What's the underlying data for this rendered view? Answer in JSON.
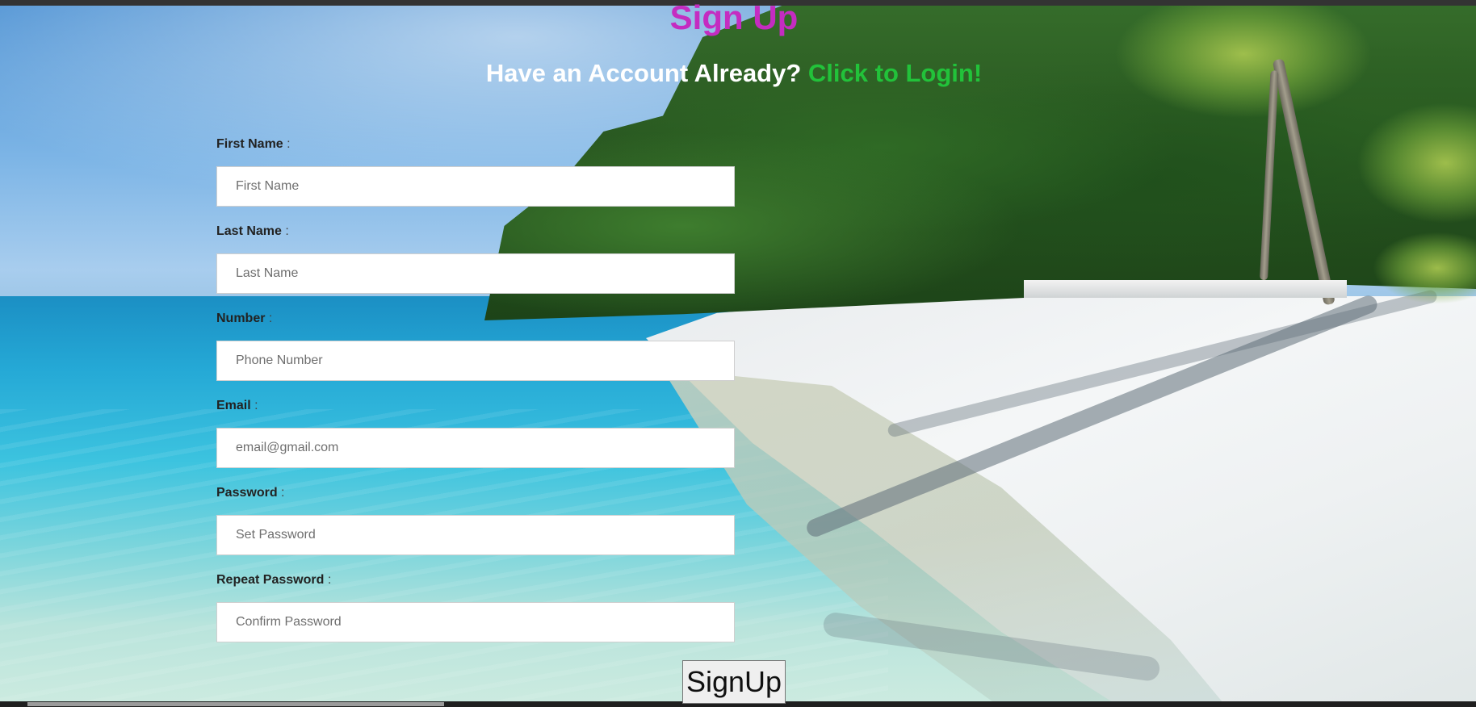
{
  "page": {
    "title": "Sign Up",
    "subtitle_prefix": "Have an Account Already?",
    "login_link": "Click to Login!"
  },
  "colors": {
    "title": "#c42cc1",
    "login_link": "#22c23a",
    "subtitle": "#ffffff"
  },
  "form": {
    "fields": [
      {
        "label": "First Name",
        "separator": ":",
        "placeholder": "First Name",
        "value": "",
        "type": "text"
      },
      {
        "label": "Last Name",
        "separator": ":",
        "placeholder": "Last Name",
        "value": "",
        "type": "text"
      },
      {
        "label": "Number",
        "separator": ":",
        "placeholder": "Phone Number",
        "value": "",
        "type": "text"
      },
      {
        "label": "Email",
        "separator": ":",
        "placeholder": "email@gmail.com",
        "value": "",
        "type": "email"
      },
      {
        "label": "Password",
        "separator": ":",
        "placeholder": "Set Password",
        "value": "",
        "type": "password"
      },
      {
        "label": "Repeat Password",
        "separator": ":",
        "placeholder": "Confirm Password",
        "value": "",
        "type": "password"
      }
    ],
    "submit_label": "SignUp"
  },
  "background": {
    "scene": "tropical-beach-image"
  }
}
